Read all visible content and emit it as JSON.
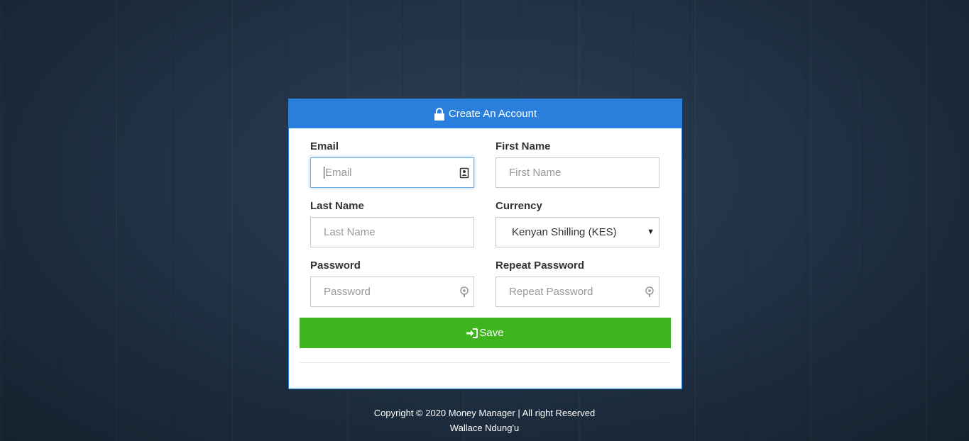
{
  "card": {
    "title": "Create An Account",
    "title_icon": "lock-icon"
  },
  "form": {
    "email": {
      "label": "Email",
      "placeholder": "Email",
      "icon": "contact-card-icon"
    },
    "first_name": {
      "label": "First Name",
      "placeholder": "First Name"
    },
    "last_name": {
      "label": "Last Name",
      "placeholder": "Last Name"
    },
    "currency": {
      "label": "Currency",
      "selected": "Kenyan Shilling (KES)"
    },
    "password": {
      "label": "Password",
      "placeholder": "Password",
      "icon": "key-icon"
    },
    "repeat_password": {
      "label": "Repeat Password",
      "placeholder": "Repeat Password",
      "icon": "key-icon"
    },
    "save_label": "Save",
    "save_icon": "sign-in-icon"
  },
  "footer": {
    "line1": "Copyright © 2020 Money Manager | All right Reserved",
    "line2": "Wallace Ndung'u"
  },
  "colors": {
    "header_blue": "#2a7fdc",
    "save_green": "#3db51d",
    "background": "#1e2f41"
  }
}
